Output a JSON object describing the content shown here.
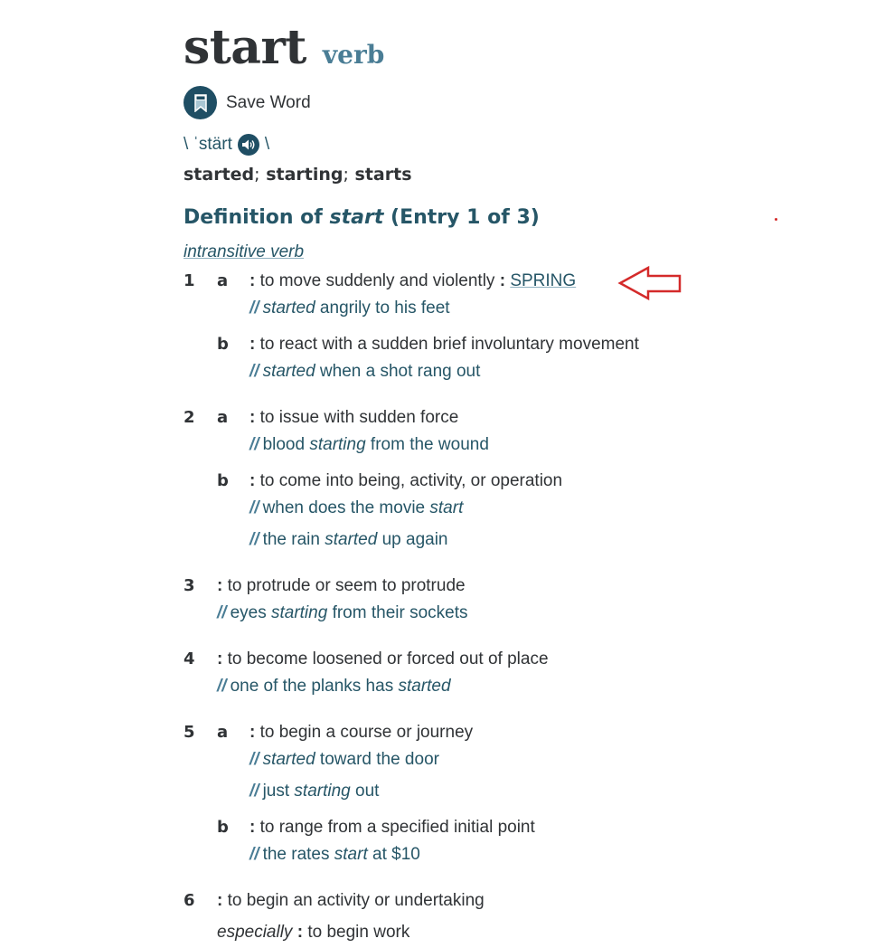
{
  "headword": "start",
  "part_of_speech": "verb",
  "save_word": {
    "label": "Save Word",
    "icon": "bookmark-icon"
  },
  "pronunciation": {
    "open": "\\",
    "text": "ˈstärt",
    "close": "\\",
    "icon": "speaker-icon"
  },
  "inflections": [
    "started",
    "starting",
    "starts"
  ],
  "inflection_separator": ";",
  "entry_heading": {
    "prefix": "Definition of ",
    "word": "start",
    "suffix": " (Entry 1 of 3)"
  },
  "sub_pos": "intransitive verb",
  "senses": [
    {
      "num": "1",
      "letter": "a",
      "def": "to move suddenly and violently",
      "synonym": "SPRING",
      "examples": [
        {
          "parts": [
            {
              "t": "started",
              "i": true
            },
            {
              "t": " angrily to his feet",
              "i": false
            }
          ]
        }
      ]
    },
    {
      "num": "",
      "letter": "b",
      "def": "to react with a sudden brief involuntary movement",
      "examples": [
        {
          "parts": [
            {
              "t": "started",
              "i": true
            },
            {
              "t": " when a shot rang out",
              "i": false
            }
          ]
        }
      ]
    },
    {
      "num": "2",
      "letter": "a",
      "def": "to issue with sudden force",
      "examples": [
        {
          "parts": [
            {
              "t": "blood ",
              "i": false
            },
            {
              "t": "starting",
              "i": true
            },
            {
              "t": " from the wound",
              "i": false
            }
          ]
        }
      ]
    },
    {
      "num": "",
      "letter": "b",
      "def": "to come into being, activity, or operation",
      "examples": [
        {
          "parts": [
            {
              "t": "when does the movie ",
              "i": false
            },
            {
              "t": "start",
              "i": true
            }
          ]
        },
        {
          "parts": [
            {
              "t": "the rain ",
              "i": false
            },
            {
              "t": "started",
              "i": true
            },
            {
              "t": " up again",
              "i": false
            }
          ]
        }
      ]
    },
    {
      "num": "3",
      "letter": "",
      "def": "to protrude or seem to protrude",
      "examples": [
        {
          "parts": [
            {
              "t": "eyes ",
              "i": false
            },
            {
              "t": "starting",
              "i": true
            },
            {
              "t": " from their sockets",
              "i": false
            }
          ]
        }
      ]
    },
    {
      "num": "4",
      "letter": "",
      "def": "to become loosened or forced out of place",
      "examples": [
        {
          "parts": [
            {
              "t": "one of the planks has ",
              "i": false
            },
            {
              "t": "started",
              "i": true
            }
          ]
        }
      ]
    },
    {
      "num": "5",
      "letter": "a",
      "def": "to begin a course or journey",
      "examples": [
        {
          "parts": [
            {
              "t": "started",
              "i": true
            },
            {
              "t": " toward the door",
              "i": false
            }
          ]
        },
        {
          "parts": [
            {
              "t": "just ",
              "i": false
            },
            {
              "t": "starting",
              "i": true
            },
            {
              "t": " out",
              "i": false
            }
          ]
        }
      ]
    },
    {
      "num": "",
      "letter": "b",
      "def": "to range from a specified initial point",
      "examples": [
        {
          "parts": [
            {
              "t": "the rates ",
              "i": false
            },
            {
              "t": "start",
              "i": true
            },
            {
              "t": " at $10",
              "i": false
            }
          ]
        }
      ]
    },
    {
      "num": "6",
      "letter": "",
      "def": "to begin an activity or undertaking",
      "sub": {
        "label": "especially",
        "def": "to begin work"
      },
      "examples": []
    }
  ],
  "example_marker": "//",
  "annotation": {
    "icon": "red-arrow-icon",
    "color": "#d42a2a"
  },
  "colors": {
    "text": "#303336",
    "accent": "#265667",
    "accent_light": "#4a7d95",
    "icon_bg": "#1f4e64"
  }
}
